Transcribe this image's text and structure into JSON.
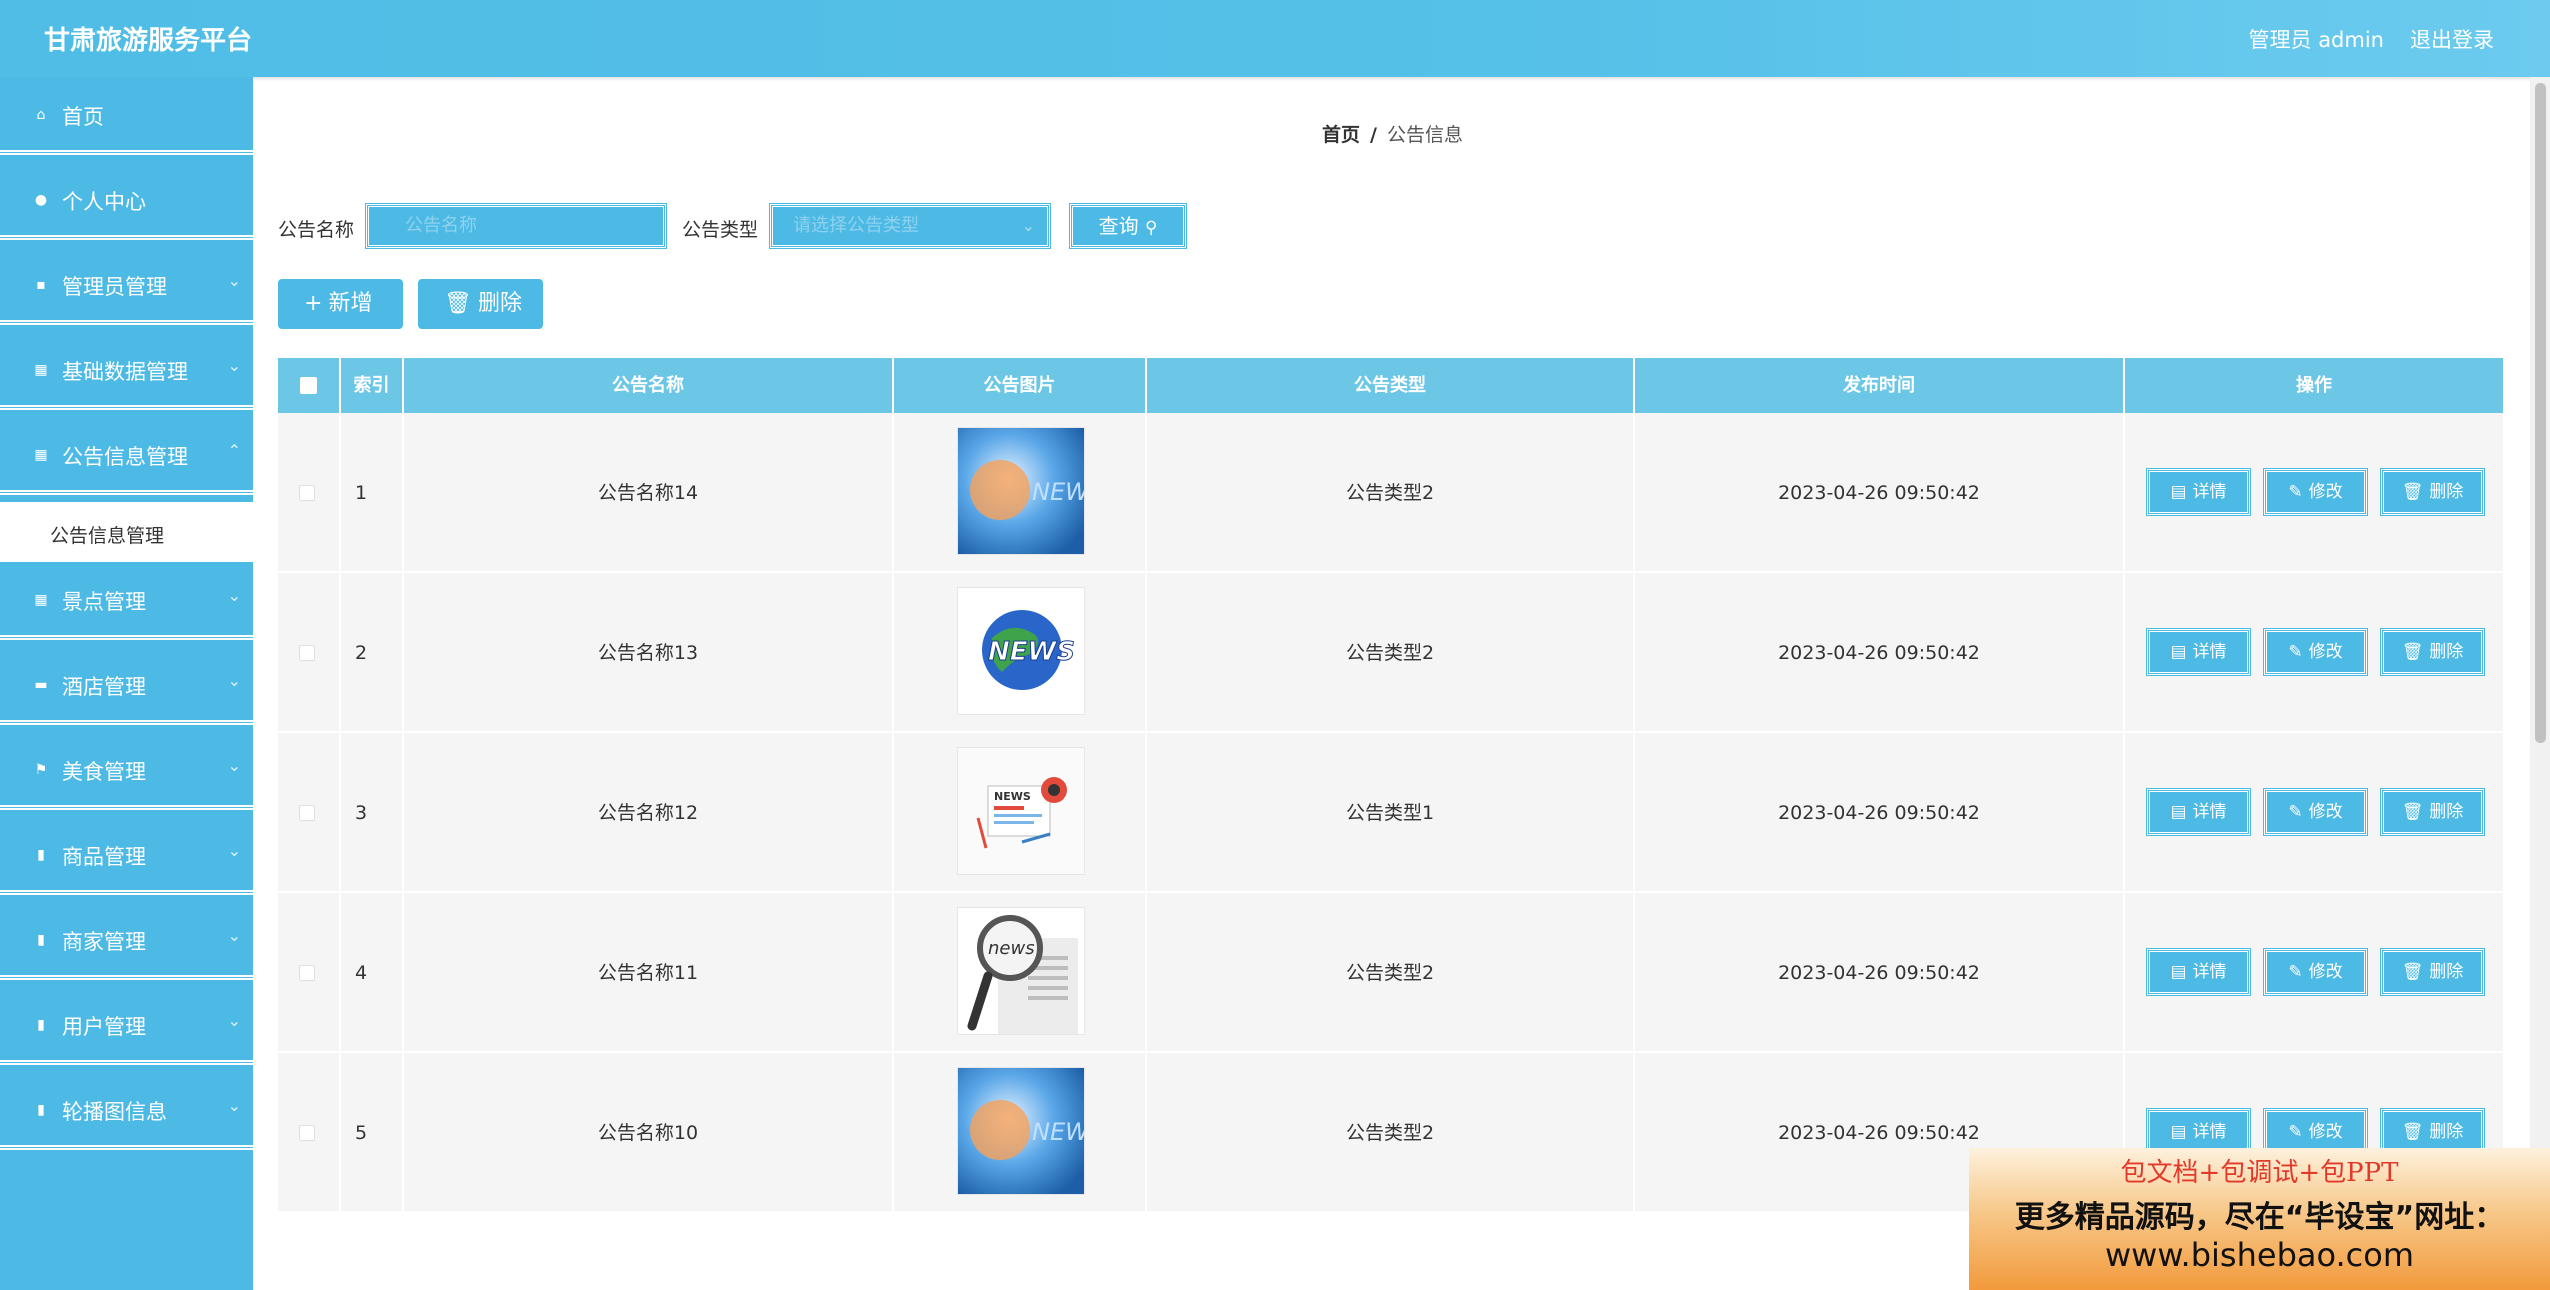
{
  "header": {
    "title": "甘肃旅游服务平台",
    "admin_label": "管理员 admin",
    "logout": "退出登录"
  },
  "sidebar": {
    "items": [
      {
        "label": "首页",
        "icon": "home-icon"
      },
      {
        "label": "个人中心",
        "icon": "user-icon"
      },
      {
        "label": "管理员管理",
        "icon": "admin-icon"
      },
      {
        "label": "基础数据管理",
        "icon": "grid-icon"
      },
      {
        "label": "公告信息管理",
        "icon": "grid-icon"
      },
      {
        "label": "景点管理",
        "icon": "grid-icon"
      },
      {
        "label": "酒店管理",
        "icon": "hotel-icon"
      },
      {
        "label": "美食管理",
        "icon": "flag-icon"
      },
      {
        "label": "商品管理",
        "icon": "goods-icon"
      },
      {
        "label": "商家管理",
        "icon": "shop-icon"
      },
      {
        "label": "用户管理",
        "icon": "users-icon"
      },
      {
        "label": "轮播图信息",
        "icon": "carousel-icon"
      }
    ],
    "submenu_label": "公告信息管理"
  },
  "breadcrumb": {
    "home": "首页",
    "separator": "/",
    "current": "公告信息"
  },
  "search": {
    "name_label": "公告名称",
    "name_placeholder": "公告名称",
    "type_label": "公告类型",
    "type_placeholder": "请选择公告类型",
    "query_label": "查询"
  },
  "actions": {
    "add_label": "新增",
    "delete_label": "删除"
  },
  "table": {
    "headers": [
      "索引",
      "公告名称",
      "公告图片",
      "公告类型",
      "发布时间",
      "操作"
    ],
    "row_actions": {
      "detail": "详情",
      "edit": "修改",
      "delete": "删除"
    },
    "rows": [
      {
        "index": "1",
        "name": "公告名称14",
        "type": "公告类型2",
        "time": "2023-04-26 09:50:42",
        "image": "news-globe-blue"
      },
      {
        "index": "2",
        "name": "公告名称13",
        "type": "公告类型2",
        "time": "2023-04-26 09:50:42",
        "image": "news-globe-earth"
      },
      {
        "index": "3",
        "name": "公告名称12",
        "type": "公告类型1",
        "time": "2023-04-26 09:50:42",
        "image": "news-paper-icon"
      },
      {
        "index": "4",
        "name": "公告名称11",
        "type": "公告类型2",
        "time": "2023-04-26 09:50:42",
        "image": "news-magnifier"
      },
      {
        "index": "5",
        "name": "公告名称10",
        "type": "公告类型2",
        "time": "2023-04-26 09:50:42",
        "image": "news-globe-blue"
      }
    ]
  },
  "ad": {
    "line1": "包文档+包调试+包PPT",
    "line2": "更多精品源码，尽在“毕设宝”网址：",
    "line3": "www.bishebao.com"
  }
}
